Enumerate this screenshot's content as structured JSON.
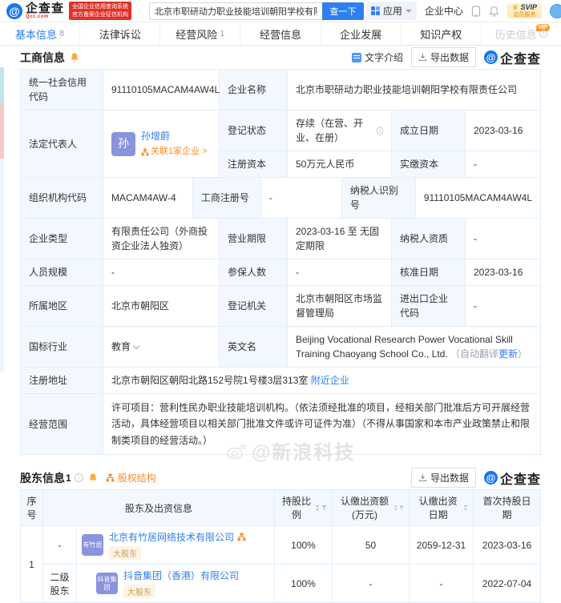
{
  "header": {
    "brand": "企查查",
    "brand_sub": "Qcc.com",
    "badge_line1": "全国企业信用查询系统",
    "badge_line2": "官方备案企业征信机构",
    "search": {
      "value": "北京市职研动力职业技能培训朝阳学校有限责任公...",
      "button": "查一下"
    },
    "nav": {
      "apps": "应用",
      "enterprise_center": "企业中心",
      "svip": "SVIP",
      "svip_sub": "会员服务"
    }
  },
  "tabs": [
    {
      "label": "基本信息",
      "count": "8"
    },
    {
      "label": "法律诉讼",
      "count": ""
    },
    {
      "label": "经营风险",
      "count": "1"
    },
    {
      "label": "经营信息",
      "count": ""
    },
    {
      "label": "企业发展",
      "count": ""
    },
    {
      "label": "知识产权",
      "count": ""
    },
    {
      "label": "历史信息",
      "count": "",
      "vip": "VIP"
    }
  ],
  "common": {
    "export": "导出数据",
    "qcc_watermark": "企查查"
  },
  "business_section": {
    "title": "工商信息",
    "text_intro": "文字介绍"
  },
  "biz": {
    "credit_code_label": "统一社会信用代码",
    "credit_code": "91110105MACAM4AW4L",
    "name_label": "企业名称",
    "name": "北京市职研动力职业技能培训朝阳学校有限责任公司",
    "legal_rep_label": "法定代表人",
    "legal_rep_avatar": "孙",
    "legal_rep_name": "孙增蔚",
    "legal_rep_related": "关联1家企业 >",
    "status_label": "登记状态",
    "status": "存续（在营、开业、在册）",
    "est_date_label": "成立日期",
    "est_date": "2023-03-16",
    "reg_capital_label": "注册资本",
    "reg_capital": "50万元人民币",
    "paid_capital_label": "实缴资本",
    "paid_capital": "-",
    "org_code_label": "组织机构代码",
    "org_code": "MACAM4AW-4",
    "reg_no_label": "工商注册号",
    "reg_no": "-",
    "taxpayer_id_label": "纳税人识别号",
    "taxpayer_id": "91110105MACAM4AW4L",
    "company_type_label": "企业类型",
    "company_type": "有限责任公司（外商投资企业法人独资）",
    "term_label": "营业期限",
    "term": "2023-03-16 至 无固定期限",
    "taxpayer_quality_label": "纳税人资质",
    "taxpayer_quality": "-",
    "staff_size_label": "人员规模",
    "staff_size": "-",
    "insured_label": "参保人数",
    "insured": "-",
    "approval_date_label": "核准日期",
    "approval_date": "2023-03-16",
    "region_label": "所属地区",
    "region": "北京市朝阳区",
    "authority_label": "登记机关",
    "authority": "北京市朝阳区市场监督管理局",
    "import_export_label": "进出口企业代码",
    "import_export": "-",
    "industry_label": "国标行业",
    "industry": "教育",
    "english_name_label": "英文名",
    "english_name": "Beijing Vocational Research Power Vocational Skill Training Chaoyang School Co., Ltd.",
    "english_note_pre": "（自动翻译",
    "english_note_link": "更新",
    "english_note_post": "）",
    "address_label": "注册地址",
    "address": "北京市朝阳区朝阳北路152号院1号楼3层313室",
    "address_link": "附近企业",
    "scope_label": "经营范围",
    "scope": "许可项目：营利性民办职业技能培训机构。（依法须经批准的项目，经相关部门批准后方可开展经营活动，具体经营项目以相关部门批准文件或许可证件为准）（不得从事国家和本市产业政策禁止和限制类项目的经营活动。）"
  },
  "shareholders": {
    "title": "股东信息",
    "count": "1",
    "structure_link": "股权结构",
    "columns": {
      "seq": "序号",
      "info": "股东及出资信息",
      "ratio": "持股比例",
      "amount": "认缴出资额(万元)",
      "date": "认缴出资日期",
      "first_date": "首次持股日期"
    },
    "rows": [
      {
        "seq": "1",
        "level": "-",
        "logo": "有竹居",
        "name": "北京有竹居网络技术有限公司",
        "tag": "大股东",
        "ratio": "100%",
        "amount": "50",
        "date": "2059-12-31",
        "first_date": "2023-03-16"
      },
      {
        "level": "二级股东",
        "logo": "抖音集团",
        "name": "抖音集团（香港）有限公司",
        "tag": "大股东",
        "ratio": "100%",
        "amount": "-",
        "date": "-",
        "first_date": "2022-07-04"
      }
    ]
  },
  "overlay": {
    "weibo_watermark": "@新浪科技"
  }
}
